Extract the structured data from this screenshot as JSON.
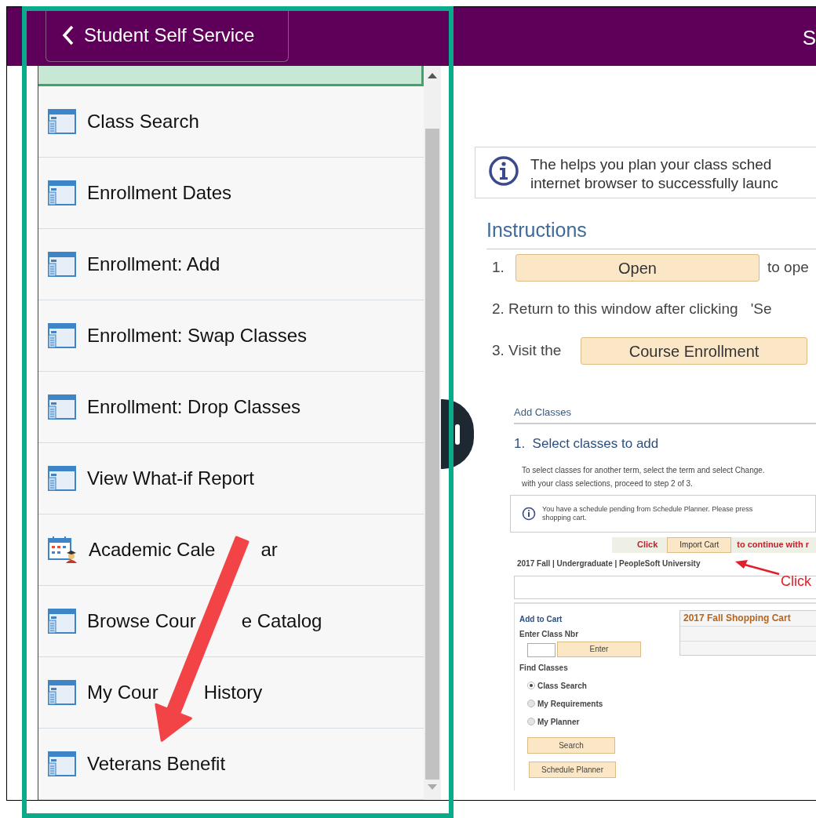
{
  "header": {
    "back_label": "Student Self Service",
    "title": "S"
  },
  "sidebar": {
    "top_item_selected": true,
    "items": [
      {
        "label": "Class Search",
        "kind": "page",
        "selected": false
      },
      {
        "label": "Enrollment Dates",
        "kind": "page",
        "selected": false
      },
      {
        "label": "Enrollment: Add",
        "kind": "page",
        "selected": false
      },
      {
        "label": "Enrollment:  Swap Classes",
        "kind": "page",
        "selected": false
      },
      {
        "label": "Enrollment:  Drop Classes",
        "kind": "page",
        "selected": false
      },
      {
        "label": "View What-if Report",
        "kind": "page",
        "selected": false
      },
      {
        "label_parts": [
          "Academic Cale",
          "ar"
        ],
        "kind": "calendar",
        "selected": false
      },
      {
        "label_parts": [
          "Browse Cour",
          "e Catalog"
        ],
        "kind": "page",
        "selected": false
      },
      {
        "label_parts": [
          "My Cour",
          "History"
        ],
        "kind": "page",
        "selected": false
      },
      {
        "label": "Veterans Benefit",
        "kind": "page",
        "selected": false
      }
    ]
  },
  "main": {
    "info_lines": [
      "The  helps you plan your class sched",
      "internet browser to successfully launc"
    ],
    "instructions_title": "Instructions",
    "steps": [
      {
        "kind": "button_first",
        "number": "1.",
        "button": "Open",
        "after": "to ope"
      },
      {
        "kind": "text",
        "text": "2. Return to this window after clicking",
        "after": "'Se"
      },
      {
        "kind": "button_last",
        "text": "3. Visit the",
        "button": "Course Enrollment"
      }
    ],
    "embedded_screenshot": {
      "title": "Add Classes",
      "step_title": "1.  Select classes to add",
      "paragraph_lines": [
        "To select classes for another term, select the term and select Change.",
        "with your class selections, proceed to step 2 of 3."
      ],
      "notice_lines": [
        "You have a schedule pending from Schedule Planner. Please press",
        "shopping cart."
      ],
      "click_label": "Click",
      "import_button": "Import Cart",
      "continue_text": "to continue with r",
      "term_line": "2017 Fall | Undergraduate | PeopleSoft University",
      "callout": "Click",
      "add_to_cart": "Add to Cart",
      "enter_class_label": "Enter Class Nbr",
      "enter_button": "Enter",
      "find_classes": "Find Classes",
      "options": [
        {
          "label": "Class Search",
          "selected": true
        },
        {
          "label": "My Requirements",
          "selected": false
        },
        {
          "label": "My Planner",
          "selected": false
        }
      ],
      "search_button": "Search",
      "planner_button": "Schedule Planner",
      "cart_title": "2017 Fall Shopping Cart"
    }
  }
}
